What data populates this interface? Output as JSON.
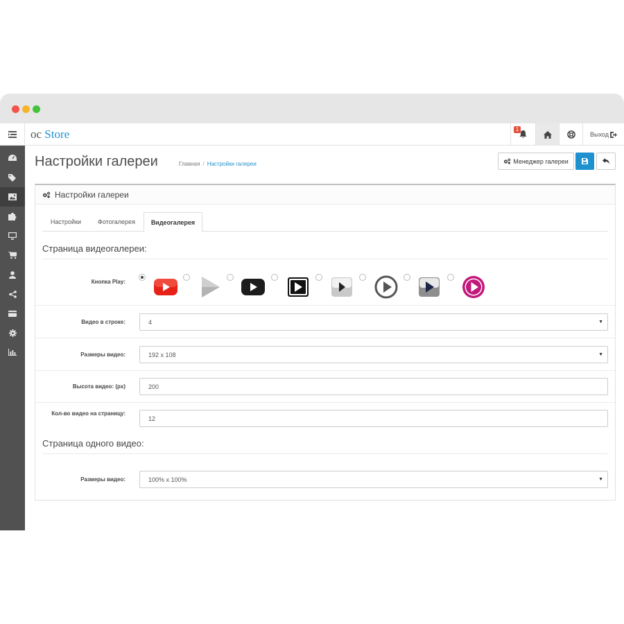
{
  "header": {
    "logo_prefix": "oc",
    "logo_suffix": "Store",
    "notification_count": "1",
    "logout_label": "Выход"
  },
  "page": {
    "title": "Настройки галереи",
    "breadcrumb": [
      "Главная",
      "Настройки галереи"
    ]
  },
  "actions": {
    "manager_label": "Менеджер галереи"
  },
  "panel": {
    "heading": "Настройки галереи",
    "tabs": [
      "Настройки",
      "Фотогалерея",
      "Видеогалерея"
    ],
    "active_tab": "Видеогалерея"
  },
  "video_page": {
    "title": "Страница видеогалереи:",
    "play_label": "Кнопка Play:",
    "play_options": [
      "youtube-red",
      "grey-triangle",
      "youtube-black",
      "black-square",
      "grey-square",
      "circle-outline",
      "dark-square",
      "pink-circle"
    ],
    "selected_play": "youtube-red",
    "per_row_label": "Видео в строке:",
    "per_row_value": "4",
    "size_label": "Размеры видео:",
    "size_value": "192 x 108",
    "height_label": "Высота видео: (px)",
    "height_value": "200",
    "per_page_label": "Кол-во видео на страницу:",
    "per_page_value": "12"
  },
  "single_video": {
    "title": "Страница одного видео:",
    "size_label": "Размеры видео:",
    "size_value": "100% x 100%"
  },
  "colors": {
    "accent": "#1e91cf",
    "sidebar": "#515151",
    "youtube_red": "#e62117",
    "pink": "#c2187a"
  }
}
